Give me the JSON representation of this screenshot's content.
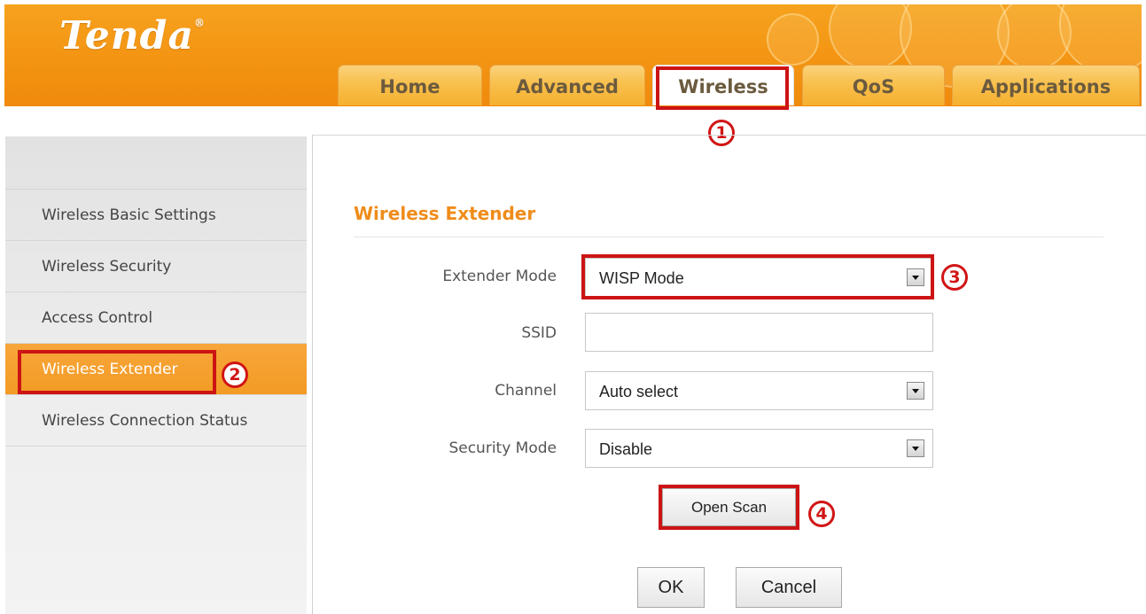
{
  "header": {
    "logo_text": "Tenda",
    "logo_mark": "®",
    "tabs": [
      {
        "label": "Home"
      },
      {
        "label": "Advanced"
      },
      {
        "label": "Wireless"
      },
      {
        "label": "QoS"
      },
      {
        "label": "Applications"
      }
    ],
    "active_tab": "Wireless"
  },
  "sidebar": {
    "items": [
      {
        "label": "Wireless Basic Settings"
      },
      {
        "label": "Wireless Security"
      },
      {
        "label": "Access Control"
      },
      {
        "label": "Wireless Extender"
      },
      {
        "label": "Wireless Connection Status"
      }
    ],
    "active_item": "Wireless Extender"
  },
  "main": {
    "title": "Wireless Extender",
    "extender_mode": {
      "label": "Extender Mode",
      "value": "WISP Mode"
    },
    "ssid": {
      "label": "SSID",
      "value": ""
    },
    "channel": {
      "label": "Channel",
      "value": "Auto select"
    },
    "security_mode": {
      "label": "Security Mode",
      "value": "Disable"
    },
    "open_scan_label": "Open Scan",
    "ok_label": "OK",
    "cancel_label": "Cancel"
  },
  "annotations": {
    "step1": "1",
    "step2": "2",
    "step3": "3",
    "step4": "4",
    "highlight_color": "#cc1414"
  },
  "colors": {
    "brand_orange": "#f39312",
    "title_orange": "#ef8c1a"
  }
}
